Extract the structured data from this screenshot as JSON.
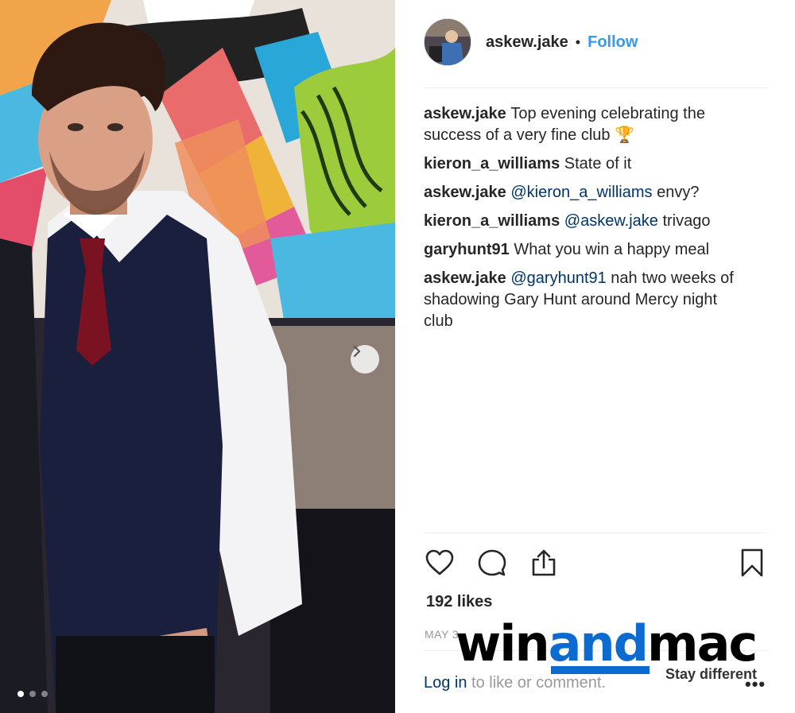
{
  "post": {
    "username": "askew.jake",
    "separator": "•",
    "follow_label": "Follow",
    "likes": "192 likes",
    "date": "MAY 3",
    "login_link": "Log in",
    "login_rest": " to like or comment.",
    "more": "•••",
    "carousel": {
      "total": 3,
      "active": 1
    }
  },
  "comments": [
    {
      "user": "askew.jake",
      "mention": "",
      "text": "Top evening celebrating the success of a very fine club 🏆"
    },
    {
      "user": "kieron_a_williams",
      "mention": "",
      "text": "State of it"
    },
    {
      "user": "askew.jake",
      "mention": "@kieron_a_williams",
      "text": " envy?"
    },
    {
      "user": "kieron_a_williams",
      "mention": "@askew.jake",
      "text": " trivago"
    },
    {
      "user": "garyhunt91",
      "mention": "",
      "text": "What you win a happy meal"
    },
    {
      "user": "askew.jake",
      "mention": "@garyhunt91",
      "text": " nah two weeks of shadowing Gary Hunt around Mercy night club"
    }
  ],
  "watermark": {
    "part1": "win",
    "part2": "and",
    "part3": "mac",
    "tagline": "Stay different",
    "brand_color": "#0b6bd1"
  },
  "icons": {
    "like": "heart-icon",
    "comment": "comment-icon",
    "share": "share-icon",
    "save": "bookmark-icon",
    "next": "chevron-right-icon"
  }
}
